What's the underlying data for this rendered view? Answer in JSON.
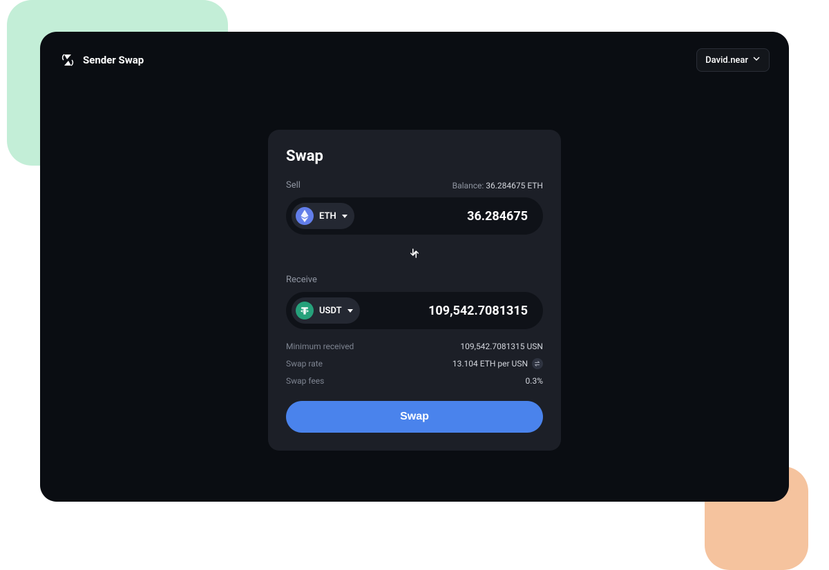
{
  "header": {
    "app_name": "Sender Swap",
    "account_label": "David.near"
  },
  "swap": {
    "title": "Swap",
    "sell": {
      "label": "Sell",
      "balance_prefix": "Balance: ",
      "balance_value": "36.284675 ETH",
      "token_symbol": "ETH",
      "amount": "36.284675"
    },
    "receive": {
      "label": "Receive",
      "token_symbol": "USDT",
      "amount": "109,542.7081315"
    },
    "details": {
      "min_received_label": "Minimum received",
      "min_received_value": "109,542.7081315 USN",
      "swap_rate_label": "Swap rate",
      "swap_rate_value": "13.104 ETH per USN",
      "swap_fees_label": "Swap fees",
      "swap_fees_value": "0.3%"
    },
    "button_label": "Swap"
  },
  "colors": {
    "accent": "#4a83ec",
    "eth": "#627eea",
    "usdt": "#26a17b"
  }
}
